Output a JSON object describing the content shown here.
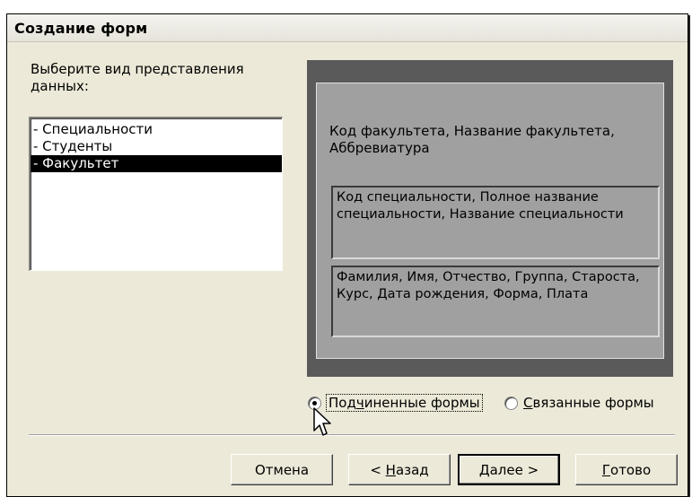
{
  "window": {
    "title": "Создание форм"
  },
  "prompt": "Выберите вид представления данных:",
  "list": {
    "items": [
      {
        "label": "- Специальности",
        "selected": false
      },
      {
        "label": "- Студенты",
        "selected": false
      },
      {
        "label": "- Факультет",
        "selected": true
      }
    ]
  },
  "preview": {
    "main_fields": "Код факультета, Название факультета, Аббревиатура",
    "subform1_fields": "Код специальности, Полное название специальности, Название специальности",
    "subform2_fields": "Фамилия, Имя, Отчество, Группа, Староста, Курс, Дата рождения, Форма, Плата"
  },
  "options": {
    "subforms": {
      "before": "Под",
      "mnemonic": "ч",
      "after": "иненные формы",
      "checked": true
    },
    "linked": {
      "before": "",
      "mnemonic": "С",
      "after": "вязанные формы",
      "checked": false
    }
  },
  "buttons": {
    "cancel": {
      "before": "Отмена",
      "mnemonic": "",
      "after": ""
    },
    "back": {
      "before": "< ",
      "mnemonic": "Н",
      "after": "азад"
    },
    "next": {
      "before": "",
      "mnemonic": "Д",
      "after": "алее >"
    },
    "finish": {
      "before": "",
      "mnemonic": "Г",
      "after": "отово"
    }
  },
  "icons": {
    "cursor": "mouse-pointer-icon"
  },
  "colors": {
    "dialog": "#ece9d8",
    "preview_outer": "#5a5a5a",
    "preview_inner": "#a0a0a0",
    "selection": "#000000"
  }
}
